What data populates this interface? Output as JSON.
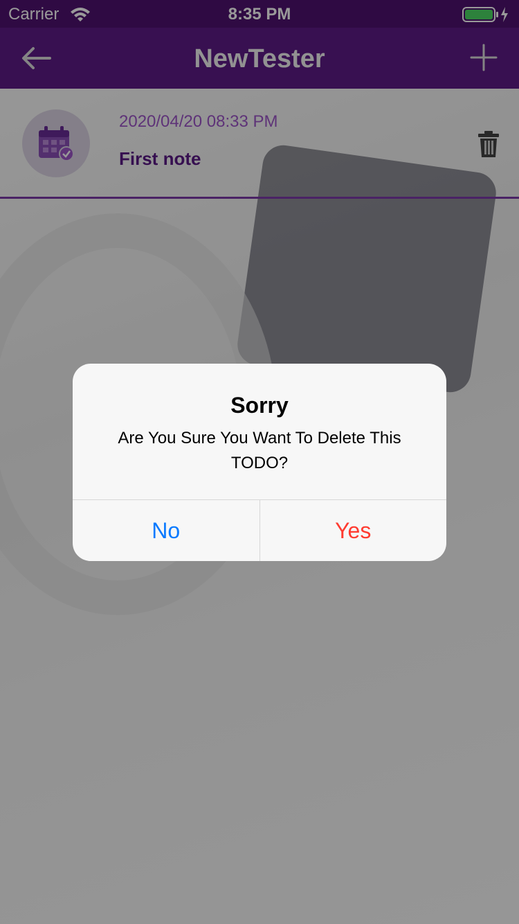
{
  "status_bar": {
    "carrier": "Carrier",
    "time": "8:35 PM",
    "wifi_icon": "wifi-icon",
    "battery_icon": "battery-charging-icon"
  },
  "nav": {
    "title": "NewTester",
    "back_icon": "back-arrow-icon",
    "add_icon": "plus-icon"
  },
  "todo": {
    "date": "2020/04/20 08:33 PM",
    "text": "First note",
    "avatar_icon": "calendar-check-icon",
    "delete_icon": "trash-icon"
  },
  "alert": {
    "title": "Sorry",
    "message": "Are You Sure You Want To Delete This TODO?",
    "no_label": "No",
    "yes_label": "Yes"
  },
  "colors": {
    "nav_bg": "#5e1c88",
    "accent": "#9d55c9",
    "no_button": "#0a7aff",
    "yes_button": "#ff3b30"
  }
}
